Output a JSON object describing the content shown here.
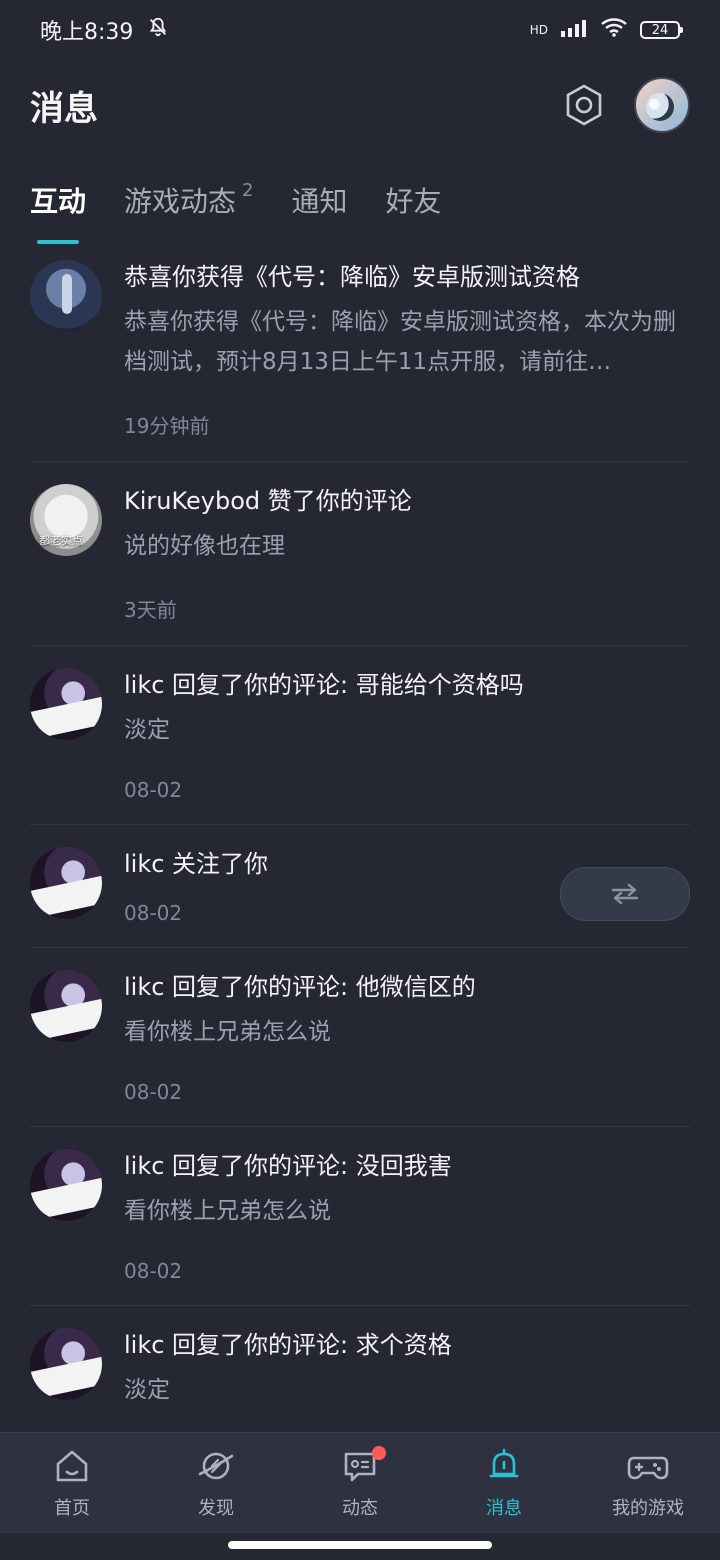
{
  "status_bar": {
    "time": "晚上8:39",
    "network": "HD",
    "battery": "24"
  },
  "header": {
    "title": "消息"
  },
  "tabs": [
    {
      "label": "互动",
      "active": true
    },
    {
      "label": "游戏动态",
      "badge": "2"
    },
    {
      "label": "通知"
    },
    {
      "label": "好友"
    }
  ],
  "items": [
    {
      "title": "恭喜你获得《代号：降临》安卓版测试资格",
      "subtitle": "恭喜你获得《代号：降临》安卓版测试资格，本次为删档测试，预计8月13日上午11点开服，请前往…",
      "time": "19分钟前"
    },
    {
      "title": "KiruKeybod 赞了你的评论",
      "subtitle": "说的好像也在理",
      "time": "3天前",
      "avatar_text": "都老实点"
    },
    {
      "title": "likc 回复了你的评论: 哥能给个资格吗",
      "subtitle": "淡定",
      "time": "08-02"
    },
    {
      "title": "likc 关注了你",
      "subtitle": "",
      "time": "08-02"
    },
    {
      "title": "likc 回复了你的评论: 他微信区的",
      "subtitle": "看你楼上兄弟怎么说",
      "time": "08-02"
    },
    {
      "title": "likc 回复了你的评论: 没回我害",
      "subtitle": "看你楼上兄弟怎么说",
      "time": "08-02"
    },
    {
      "title": "likc 回复了你的评论: 求个资格",
      "subtitle": "淡定",
      "time": ""
    }
  ],
  "bottom_nav": [
    {
      "label": "首页"
    },
    {
      "label": "发现"
    },
    {
      "label": "动态"
    },
    {
      "label": "消息",
      "active": true
    },
    {
      "label": "我的游戏"
    }
  ],
  "colors": {
    "accent": "#2bc1d0",
    "background": "#252833",
    "nav_bg": "#2e3240",
    "notification_dot": "#ff5b5b"
  }
}
